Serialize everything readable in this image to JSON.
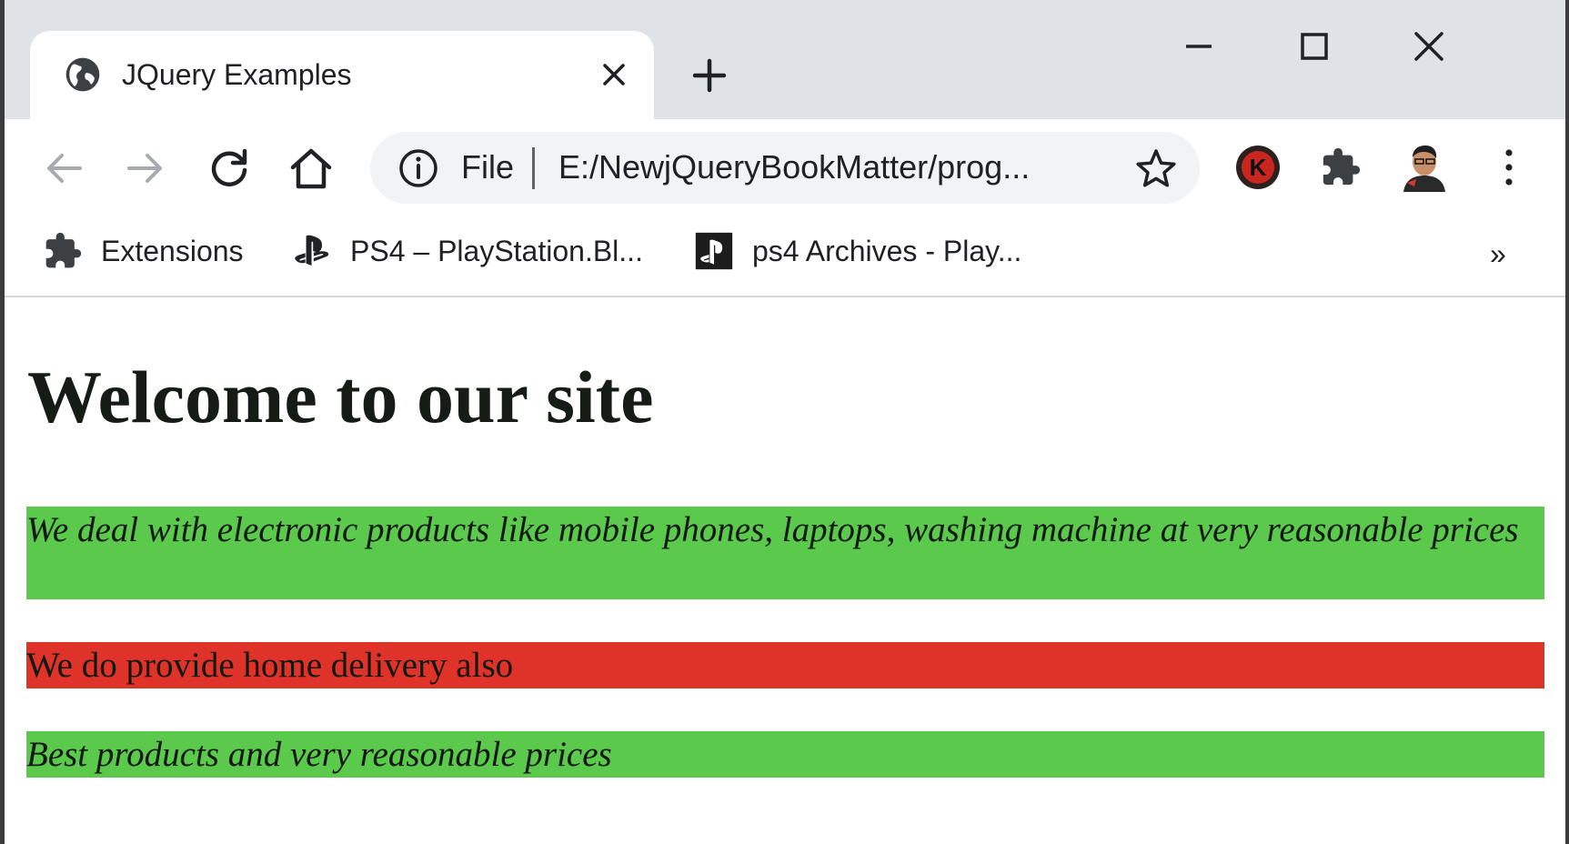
{
  "tab": {
    "title": "JQuery Examples",
    "favicon": "globe-icon",
    "close_icon": "close-icon",
    "new_tab_icon": "plus-icon"
  },
  "window_controls": [
    "minimize-icon",
    "maximize-icon",
    "close-icon"
  ],
  "toolbar": {
    "back_icon": "arrow-left-icon",
    "forward_icon": "arrow-right-icon",
    "reload_icon": "reload-icon",
    "home_icon": "home-icon",
    "address": {
      "info_icon": "info-icon",
      "scheme_label": "File",
      "url": "E:/NewjQueryBookMatter/prog...",
      "star_icon": "star-icon"
    },
    "extensions": [
      "k-extension-icon",
      "puzzle-icon"
    ],
    "profile": "profile-avatar",
    "menu_icon": "more-vert-icon"
  },
  "bookmarks": {
    "items": [
      {
        "label": "Extensions",
        "icon": "puzzle-icon"
      },
      {
        "label": "PS4 – PlayStation.Bl...",
        "icon": "playstation-icon"
      },
      {
        "label": "ps4 Archives - Play...",
        "icon": "playstation-box-icon"
      }
    ],
    "more_label": "»"
  },
  "page": {
    "heading": "Welcome to our site",
    "paragraphs": [
      {
        "text": "We deal with electronic products like mobile phones, laptops, washing machine at very reasonable prices",
        "background": "#5bc94c",
        "italic": true
      },
      {
        "text": "We do provide home delivery also",
        "background": "#df3228",
        "italic": false
      },
      {
        "text": "Best products and very reasonable prices",
        "background": "#5bc94c",
        "italic": true
      }
    ]
  },
  "colors": {
    "titlebar": "#dfe3e7",
    "omnibox": "#f1f3f4",
    "green": "#5bc94c",
    "red": "#df3228"
  }
}
